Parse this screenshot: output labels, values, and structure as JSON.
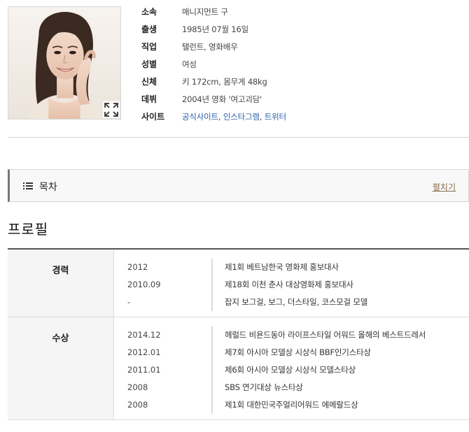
{
  "info": {
    "rows": [
      {
        "key": "소속",
        "value": "매니지먼트 구"
      },
      {
        "key": "출생",
        "value": "1985년 07월 16일"
      },
      {
        "key": "직업",
        "value": "탤런트, 영화배우"
      },
      {
        "key": "성별",
        "value": "여성"
      },
      {
        "key": "신체",
        "value": "키 172cm, 몸무게 48kg"
      },
      {
        "key": "데뷔",
        "value": "2004년 영화 '여고괴담'"
      }
    ],
    "site": {
      "key": "사이트",
      "links": [
        "공식사이트",
        "인스타그램",
        "트위터"
      ],
      "separator": ","
    },
    "link_color": "#2a62a8"
  },
  "photo": {
    "expand_icon": "expand-icon"
  },
  "toc": {
    "icon": "list-icon",
    "title": "목차",
    "toggle": "펼치기"
  },
  "profile": {
    "title": "프로필",
    "groups": [
      {
        "head": "경력",
        "rows": [
          {
            "date": "2012",
            "desc": "제1회 베트남한국 영화제 홍보대사"
          },
          {
            "date": "2010.09",
            "desc": "제18회 이천 춘사 대상영화제 홍보대사"
          },
          {
            "date": "-",
            "desc": "잡지 보그걸, 보그, 더스타일, 코스모걸 모델"
          }
        ]
      },
      {
        "head": "수상",
        "rows": [
          {
            "date": "2014.12",
            "desc": "헤럴드 비욘드동아 라이프스타일 어워드 올해의 베스트드레서"
          },
          {
            "date": "2012.01",
            "desc": "제7회 아시아 모델상 시상식 BBF인기스타상"
          },
          {
            "date": "2011.01",
            "desc": "제6회 아시아 모델상 시상식 모델스타상"
          },
          {
            "date": "2008",
            "desc": "SBS 연기대상 뉴스타상"
          },
          {
            "date": "2008",
            "desc": "제1회 대한민국주얼리어워드 에메랄드상"
          }
        ]
      }
    ]
  }
}
